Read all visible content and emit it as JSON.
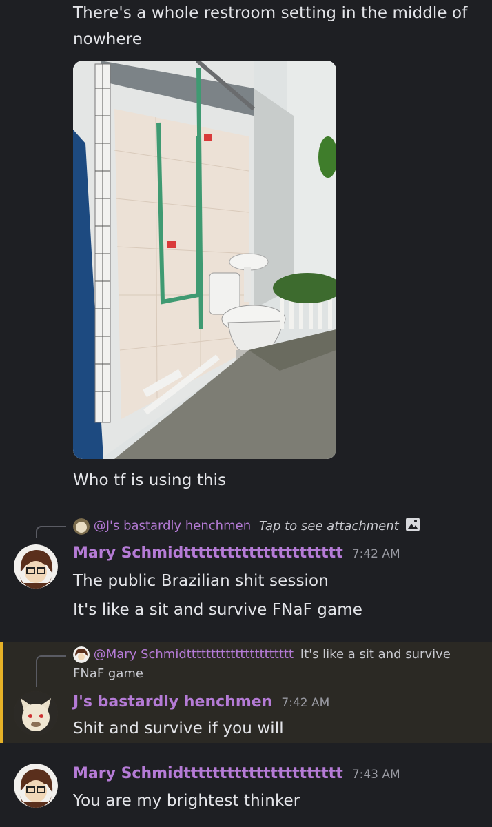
{
  "message1": {
    "caption_top": "There's a whole restroom setting in the middle of nowhere",
    "caption_bottom": "Who tf is using this"
  },
  "reply1": {
    "mention": "@J's bastardly henchmen",
    "preview": "Tap to see attachment",
    "attachment_icon": "image-icon"
  },
  "message2": {
    "author": "Mary Schmidtttttttttttttttttttttt",
    "time": "7:42 AM",
    "lines": [
      "The public Brazilian shit session",
      "It's like a sit and survive FNaF game"
    ]
  },
  "reply2": {
    "mention": "@Mary Schmidtttttttttttttttttttttt",
    "preview_line1": "It's like a sit and survive",
    "preview_line2": "FNaF game"
  },
  "message3": {
    "author": "J's bastardly henchmen",
    "time": "7:42 AM",
    "text": "Shit and survive if you will"
  },
  "message4": {
    "author": "Mary Schmidtttttttttttttttttttttt",
    "time": "7:43 AM",
    "text": "You are my brightest thinker"
  },
  "colors": {
    "background": "#1e1f23",
    "username": "#b57bd6",
    "highlight_bar": "#e6b127"
  }
}
